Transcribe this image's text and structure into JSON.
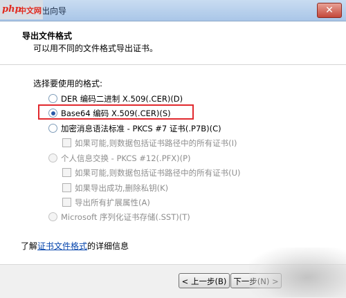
{
  "window": {
    "title": "证书导出向导",
    "close_label": "✕"
  },
  "watermark": {
    "php": "php",
    "cn": "中文网"
  },
  "header": {
    "title": "导出文件格式",
    "subtitle": "可以用不同的文件格式导出证书。"
  },
  "section_label": "选择要使用的格式:",
  "options": [
    {
      "label": "DER 编码二进制 X.509(.CER)(D)",
      "checked": false,
      "disabled": false
    },
    {
      "label": "Base64 编码 X.509(.CER)(S)",
      "checked": true,
      "disabled": false
    },
    {
      "label": "加密消息语法标准 - PKCS #7 证书(.P7B)(C)",
      "checked": false,
      "disabled": false
    },
    {
      "label": "如果可能,则数据包括证书路径中的所有证书(I)",
      "disabled": true
    },
    {
      "label": "个人信息交换 - PKCS #12(.PFX)(P)",
      "checked": false,
      "disabled": true
    },
    {
      "label": "如果可能,则数据包括证书路径中的所有证书(U)",
      "disabled": true
    },
    {
      "label": "如果导出成功,删除私钥(K)",
      "disabled": true
    },
    {
      "label": "导出所有扩展属性(A)",
      "disabled": true
    },
    {
      "label": "Microsoft 序列化证书存储(.SST)(T)",
      "checked": false,
      "disabled": true
    }
  ],
  "learn_more": {
    "prefix": "了解",
    "link": "证书文件格式",
    "suffix": "的详细信息"
  },
  "footer": {
    "back_label": "< 上一步(B)",
    "next_label": "下一步(N) >"
  },
  "colors": {
    "highlight": "#e1282d",
    "link": "#0645ad",
    "radio_dot": "#2a5aa8"
  }
}
